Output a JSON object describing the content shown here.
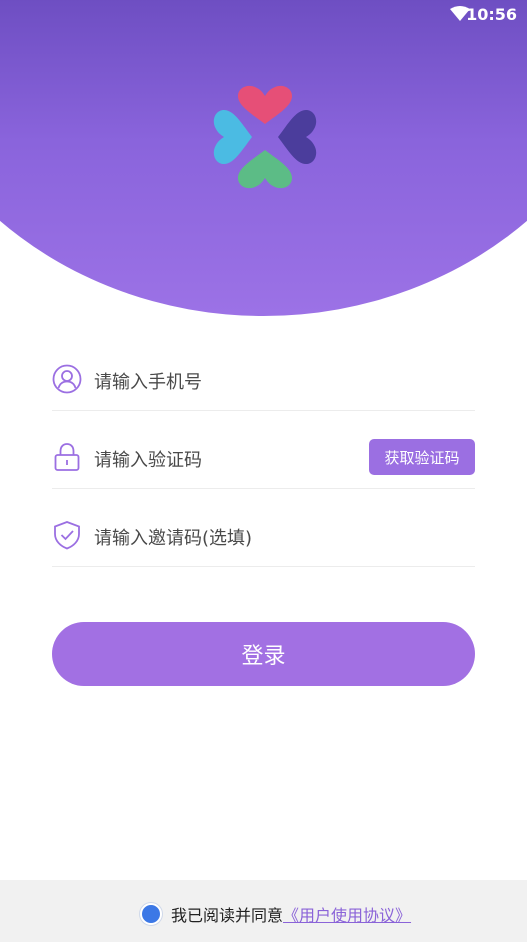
{
  "status_bar": {
    "time": "10:56"
  },
  "form": {
    "phone_placeholder": "请输入手机号",
    "code_placeholder": "请输入验证码",
    "get_code_label": "获取验证码",
    "invite_placeholder": "请输入邀请码(选填)"
  },
  "login_label": "登录",
  "agreement": {
    "text": "我已阅读并同意",
    "link": "《用户使用协议》"
  },
  "colors": {
    "accent": "#a270e3",
    "header_top": "#3c2d8e",
    "header_bottom": "#9c72e6",
    "checkbox": "#3c78e6"
  },
  "icons": [
    "wifi-icon",
    "app-logo",
    "user-icon",
    "lock-icon",
    "shield-check-icon"
  ]
}
